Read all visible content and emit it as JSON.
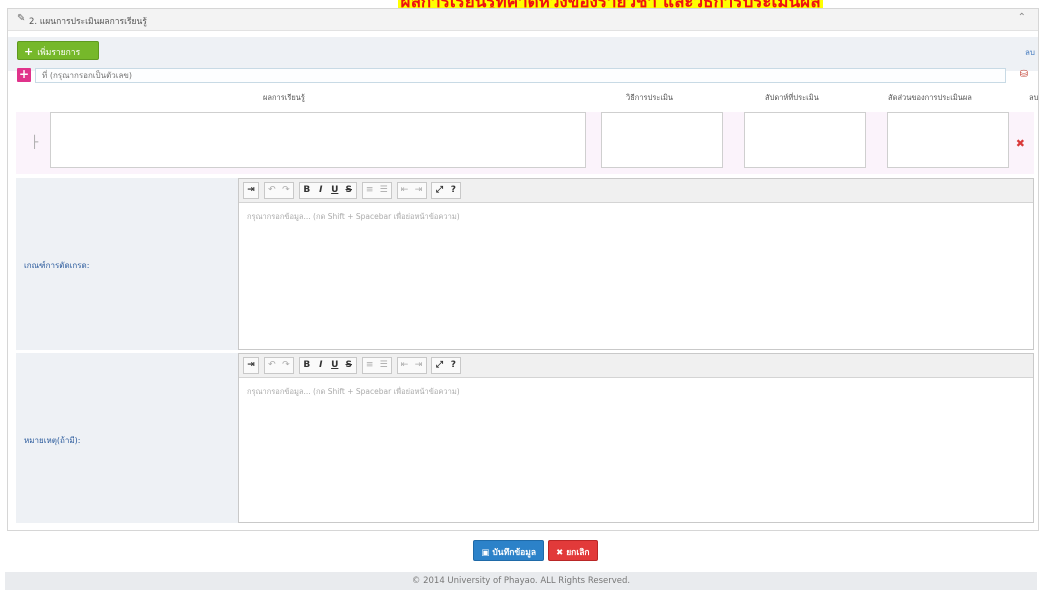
{
  "banner": {
    "text": "ผลการเรียนรู้ที่คาดหวังของรายวิชา และวิธีการประเมินผล"
  },
  "section": {
    "title": "2. แผนการประเมินผลการเรียนรู้",
    "collapse_icon": "chevron-up-icon"
  },
  "toolbar": {
    "add_label": "เพิ่มรายการ",
    "delete_label": "ลบ"
  },
  "item_no": {
    "placeholder": "ที่ (กรุณากรอกเป็นตัวเลข)"
  },
  "columns": {
    "outcome": "ผลการเรียนรู้",
    "method": "วิธีการประเมิน",
    "week": "สัปดาห์ที่ประเมิน",
    "ratio": "สัดส่วนของการประเมินผล",
    "delete": "ลบ"
  },
  "criteria": {
    "label": "เกณฑ์การตัดเกรด:",
    "placeholder": "กรุณากรอกข้อมูล... (กด Shift + Spacebar เพื่อย่อหน้าข้อความ)"
  },
  "notes": {
    "label": "หมายเหตุ(ถ้ามี):",
    "placeholder": "กรุณากรอกข้อมูล... (กด Shift + Spacebar เพื่อย่อหน้าข้อความ)"
  },
  "editor_toolbar": {
    "indent": "⇥",
    "undo": "↶",
    "redo": "↷",
    "bold": "B",
    "italic": "I",
    "underline": "U",
    "strike": "S",
    "ol": "≡",
    "ul": "☰",
    "outdent": "⇤",
    "indent2": "⇥",
    "fullscreen": "⤢",
    "help": "?"
  },
  "actions": {
    "save_label": "บันทึกข้อมูล",
    "cancel_label": "ยกเลิก"
  },
  "footer": {
    "copyright": "© 2014 University of Phayao. ALL Rights Reserved."
  },
  "colors": {
    "add": "#76b82a",
    "save": "#2c82c9",
    "cancel": "#e23a3a",
    "delete_x": "#d93a3a",
    "pink": "#e0338b"
  }
}
